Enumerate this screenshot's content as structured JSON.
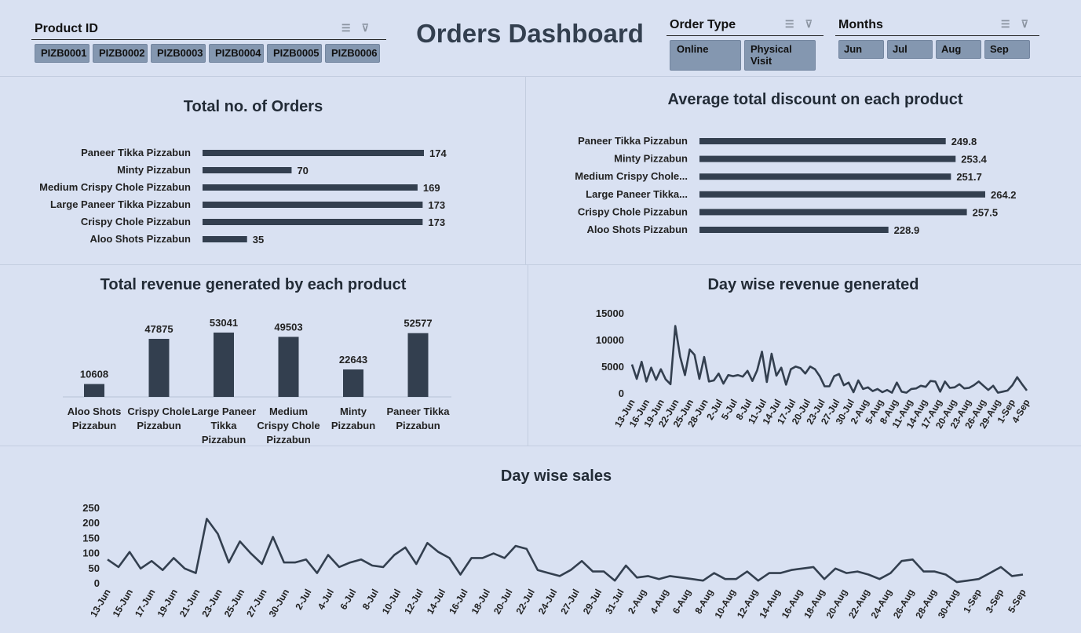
{
  "dashboard": {
    "title": "Orders Dashboard"
  },
  "slicers": {
    "product_id": {
      "label": "Product ID",
      "items": [
        "PIZB0001",
        "PIZB0002",
        "PIZB0003",
        "PIZB0004",
        "PIZB0005",
        "PIZB0006"
      ]
    },
    "order_type": {
      "label": "Order Type",
      "items": [
        "Online",
        "Physical Visit"
      ]
    },
    "months": {
      "label": "Months",
      "items": [
        "Jun",
        "Jul",
        "Aug",
        "Sep"
      ]
    },
    "icons": [
      "multi-select-icon",
      "clear-filter-icon"
    ]
  },
  "colors": {
    "background": "#d9e1f2",
    "bar": "#333f4f",
    "divider": "#c3cde0",
    "slicer_button": "#8497b0"
  },
  "chart_data": [
    {
      "id": "orders",
      "type": "bar",
      "orientation": "horizontal",
      "title": "Total no. of Orders",
      "categories": [
        "Paneer Tikka Pizzabun",
        "Minty Pizzabun",
        "Medium Crispy Chole Pizzabun",
        "Large Paneer Tikka Pizzabun",
        "Crispy Chole Pizzabun",
        "Aloo Shots Pizzabun"
      ],
      "values": [
        174,
        70,
        169,
        173,
        173,
        35
      ],
      "data_labels": true
    },
    {
      "id": "discount",
      "type": "bar",
      "orientation": "horizontal",
      "title": "Average total discount on each product",
      "categories": [
        "Paneer Tikka Pizzabun",
        "Minty Pizzabun",
        "Medium Crispy Chole...",
        "Large Paneer Tikka...",
        "Crispy Chole Pizzabun",
        "Aloo Shots Pizzabun"
      ],
      "values": [
        249.8,
        253.4,
        251.7,
        264.2,
        257.5,
        228.9
      ],
      "data_labels": true
    },
    {
      "id": "revenue",
      "type": "bar",
      "orientation": "vertical",
      "title": "Total revenue generated by each product",
      "categories": [
        "Aloo Shots Pizzabun",
        "Crispy Chole Pizzabun",
        "Large Paneer Tikka Pizzabun",
        "Medium Crispy Chole Pizzabun",
        "Minty Pizzabun",
        "Paneer Tikka Pizzabun"
      ],
      "category_lines": [
        [
          "Aloo Shots",
          "Pizzabun"
        ],
        [
          "Crispy Chole",
          "Pizzabun"
        ],
        [
          "Large Paneer",
          "Tikka",
          "Pizzabun"
        ],
        [
          "Medium",
          "Crispy Chole",
          "Pizzabun"
        ],
        [
          "Minty",
          "Pizzabun"
        ],
        [
          "Paneer Tikka",
          "Pizzabun"
        ]
      ],
      "values": [
        10608,
        47875,
        53041,
        49503,
        22643,
        52577
      ],
      "data_labels": true
    },
    {
      "id": "day_revenue",
      "type": "line",
      "title": "Day wise revenue generated",
      "ylim": [
        0,
        15000
      ],
      "yticks": [
        0,
        5000,
        10000,
        15000
      ],
      "xtick_labels": [
        "13-Jun",
        "16-Jun",
        "19-Jun",
        "22-Jun",
        "25-Jun",
        "28-Jun",
        "2-Jul",
        "5-Jul",
        "8-Jul",
        "11-Jul",
        "14-Jul",
        "17-Jul",
        "20-Jul",
        "23-Jul",
        "27-Jul",
        "30-Jul",
        "2-Aug",
        "5-Aug",
        "8-Aug",
        "11-Aug",
        "14-Aug",
        "17-Aug",
        "20-Aug",
        "23-Aug",
        "26-Aug",
        "29-Aug",
        "1-Sep",
        "4-Sep"
      ],
      "values": [
        5500,
        2800,
        6000,
        2300,
        4900,
        2600,
        4600,
        2700,
        1800,
        12700,
        7000,
        3500,
        8300,
        7300,
        2800,
        6900,
        2300,
        2500,
        3800,
        1900,
        3500,
        3300,
        3500,
        3200,
        4300,
        2400,
        4400,
        7900,
        2200,
        7500,
        3400,
        4900,
        1700,
        4600,
        5100,
        4800,
        3800,
        5100,
        4600,
        3300,
        1400,
        1400,
        3300,
        3700,
        1600,
        2100,
        300,
        2500,
        900,
        1200,
        500,
        900,
        300,
        700,
        200,
        2100,
        400,
        200,
        900,
        1000,
        1500,
        1300,
        2400,
        2300,
        400,
        2300,
        1100,
        1200,
        1800,
        1000,
        1100,
        1600,
        2300,
        1500,
        700,
        1500,
        200,
        400,
        600,
        1600,
        3100,
        1800,
        600
      ]
    },
    {
      "id": "day_sales",
      "type": "line",
      "title": "Day wise sales",
      "ylim": [
        0,
        250
      ],
      "yticks": [
        0,
        50,
        100,
        150,
        200,
        250
      ],
      "xtick_labels": [
        "13-Jun",
        "15-Jun",
        "17-Jun",
        "19-Jun",
        "21-Jun",
        "23-Jun",
        "25-Jun",
        "27-Jun",
        "30-Jun",
        "2-Jul",
        "4-Jul",
        "6-Jul",
        "8-Jul",
        "10-Jul",
        "12-Jul",
        "14-Jul",
        "16-Jul",
        "18-Jul",
        "20-Jul",
        "22-Jul",
        "24-Jul",
        "27-Jul",
        "29-Jul",
        "31-Jul",
        "2-Aug",
        "4-Aug",
        "6-Aug",
        "8-Aug",
        "10-Aug",
        "12-Aug",
        "14-Aug",
        "16-Aug",
        "18-Aug",
        "20-Aug",
        "22-Aug",
        "24-Aug",
        "26-Aug",
        "28-Aug",
        "30-Aug",
        "1-Sep",
        "3-Sep",
        "5-Sep"
      ],
      "values": [
        80,
        55,
        105,
        50,
        75,
        45,
        85,
        50,
        35,
        215,
        165,
        70,
        140,
        100,
        65,
        155,
        70,
        70,
        80,
        35,
        95,
        55,
        70,
        80,
        60,
        55,
        95,
        120,
        65,
        135,
        105,
        85,
        30,
        85,
        85,
        100,
        85,
        125,
        115,
        45,
        35,
        25,
        45,
        75,
        40,
        40,
        10,
        60,
        20,
        25,
        15,
        25,
        20,
        15,
        10,
        35,
        15,
        15,
        40,
        10,
        35,
        35,
        45,
        50,
        55,
        15,
        50,
        35,
        40,
        30,
        15,
        35,
        75,
        80,
        40,
        40,
        30,
        5,
        10,
        15,
        35,
        55,
        25,
        30
      ]
    }
  ]
}
